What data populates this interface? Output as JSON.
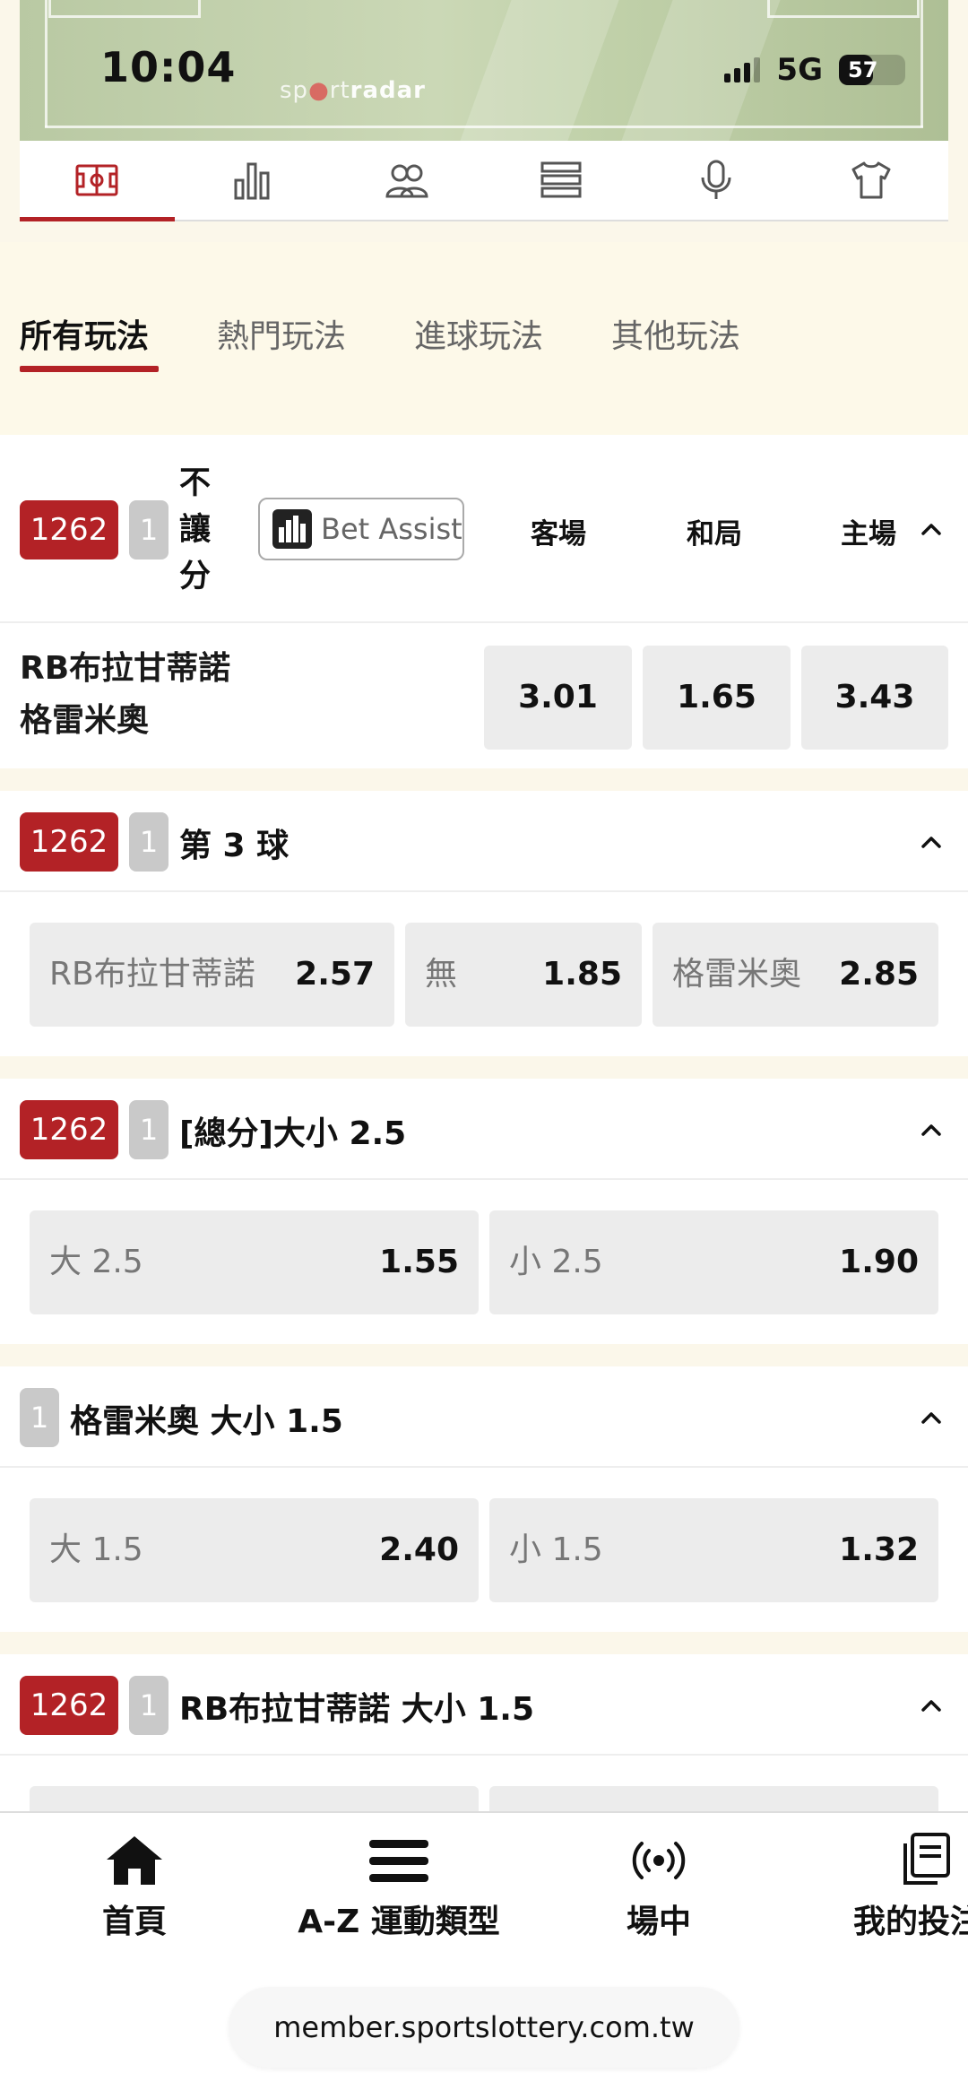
{
  "status_bar": {
    "time": "10:04",
    "network": "5G",
    "battery": "57",
    "watermark_prefix": "sp",
    "watermark_mid": "rt",
    "watermark_suffix": "radar"
  },
  "icon_tabs": [
    "field-icon",
    "bar-chart-icon",
    "lineup-icon",
    "standings-icon",
    "microphone-icon",
    "jersey-icon"
  ],
  "category_tabs": [
    {
      "label": "所有玩法",
      "active": true
    },
    {
      "label": "熱門玩法",
      "active": false
    },
    {
      "label": "進球玩法",
      "active": false
    },
    {
      "label": "其他玩法",
      "active": false
    }
  ],
  "markets": {
    "m1": {
      "id": "1262",
      "index": "1",
      "title_lines": [
        "不",
        "讓",
        "分"
      ],
      "bet_assist": "Bet Assist",
      "columns": [
        "客場",
        "和局",
        "主場"
      ],
      "team_away": "RB布拉甘蒂諾",
      "team_home": "格雷米奧",
      "odds": [
        "3.01",
        "1.65",
        "3.43"
      ]
    },
    "m2": {
      "id": "1262",
      "index": "1",
      "title": "第 3 球",
      "options": [
        {
          "label": "RB布拉甘蒂諾",
          "odds": "2.57"
        },
        {
          "label": "無",
          "odds": "1.85"
        },
        {
          "label": "格雷米奧",
          "odds": "2.85"
        }
      ]
    },
    "m3": {
      "id": "1262",
      "index": "1",
      "title": "[總分]大小 2.5",
      "options": [
        {
          "label": "大 2.5",
          "odds": "1.55"
        },
        {
          "label": "小 2.5",
          "odds": "1.90"
        }
      ]
    },
    "m4": {
      "index": "1",
      "title": "格雷米奧 大小 1.5",
      "options": [
        {
          "label": "大 1.5",
          "odds": "2.40"
        },
        {
          "label": "小 1.5",
          "odds": "1.32"
        }
      ]
    },
    "m5": {
      "id": "1262",
      "index": "1",
      "title": "RB布拉甘蒂諾 大小 1.5"
    }
  },
  "bottom_nav": [
    {
      "label": "首頁",
      "icon": "home-icon"
    },
    {
      "label": "A-Z 運動類型",
      "icon": "menu-icon"
    },
    {
      "label": "場中",
      "icon": "live-icon"
    },
    {
      "label": "我的投注",
      "icon": "my-bets-icon"
    }
  ],
  "url": "member.sportslottery.com.tw",
  "colors": {
    "accent": "#b32226",
    "tag_grey": "#c9c9c9",
    "odds_bg": "#ececec",
    "page_bg": "#fbf7ea"
  }
}
